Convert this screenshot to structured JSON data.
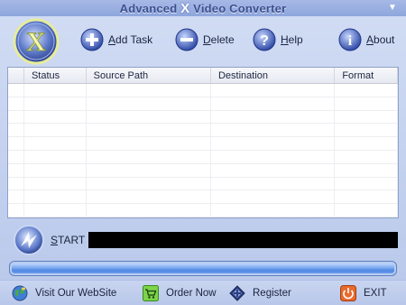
{
  "window": {
    "title_before": "Advanced ",
    "title_x": "X",
    "title_after": " Video Converter",
    "minimize_glyph": "▼"
  },
  "toolbar": {
    "add_task": "Add Task",
    "delete": "Delete",
    "help": "Help",
    "about": "About"
  },
  "table": {
    "columns": [
      "",
      "Status",
      "Source Path",
      "Destination",
      "Format"
    ]
  },
  "start": {
    "label_first": "S",
    "label_rest": "TART"
  },
  "bottom": {
    "visit": "Visit Our WebSite",
    "order": "Order Now",
    "register": "Register",
    "exit": "EXIT"
  },
  "colors": {
    "accent": "#4f88e4",
    "background": "#c3d1ef",
    "status_bar": "#000000"
  },
  "icons": {
    "logo": "x-logo-icon",
    "add_task": "plus-icon",
    "delete": "minus-icon",
    "help": "question-icon",
    "about": "info-icon",
    "start": "start-icon",
    "visit": "globe-icon",
    "order": "cart-icon",
    "register": "register-icon",
    "exit": "power-icon"
  }
}
